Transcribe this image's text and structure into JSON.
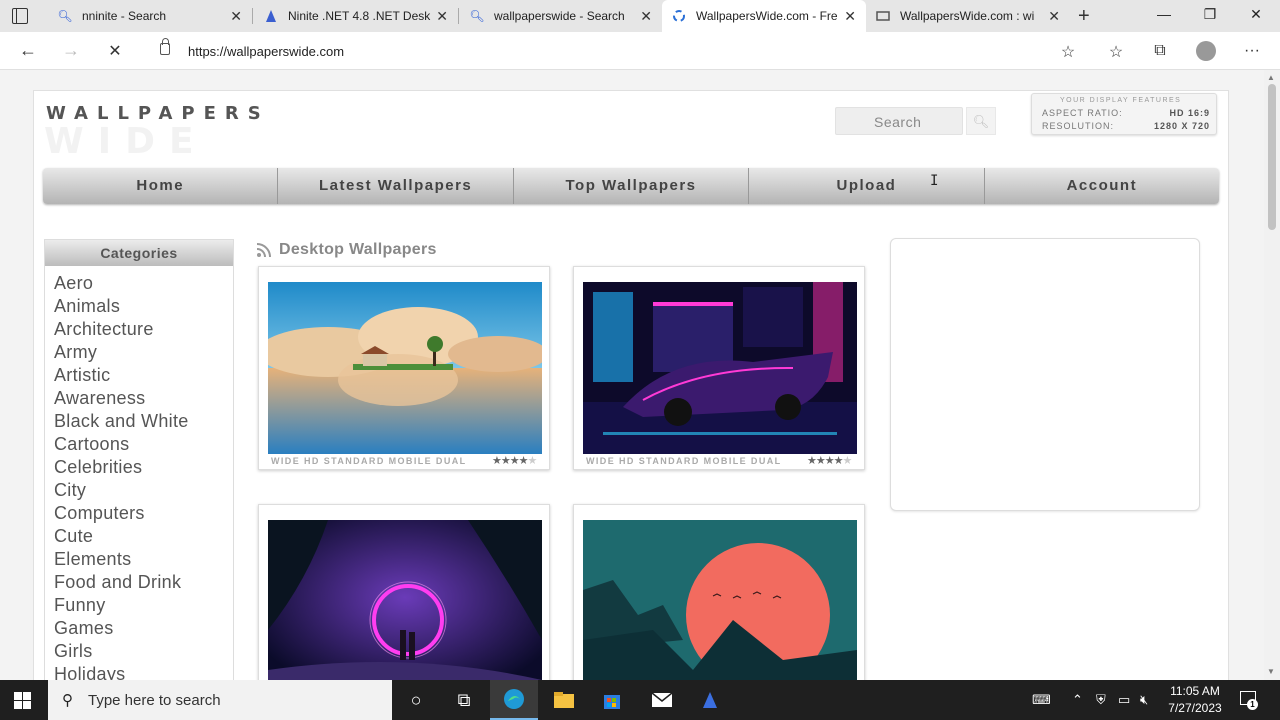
{
  "browser": {
    "tabs": [
      {
        "label": "nninite - Search",
        "icon": "search-icon",
        "active": false
      },
      {
        "label": "Ninite .NET 4.8 .NET Desk",
        "icon": "ninite-icon",
        "active": false
      },
      {
        "label": "wallpaperswide - Search",
        "icon": "search-icon",
        "active": false
      },
      {
        "label": "WallpapersWide.com - Fre",
        "icon": "loading-spinner-icon",
        "active": true
      },
      {
        "label": "WallpapersWide.com : wi",
        "icon": "site-favicon-icon",
        "active": false
      }
    ],
    "url": "https://wallpaperswide.com"
  },
  "site": {
    "logo_top": "WALLPAPERS",
    "logo_bottom": "WIDE",
    "search_placeholder": "Search",
    "display_features": {
      "title": "YOUR DISPLAY FEATURES",
      "aspect_label": "ASPECT RATIO:",
      "aspect_value": "HD 16:9",
      "resolution_label": "RESOLUTION:",
      "resolution_value": "1280 X 720"
    },
    "nav": [
      "Home",
      "Latest Wallpapers",
      "Top Wallpapers",
      "Upload",
      "Account"
    ],
    "categories_title": "Categories",
    "categories": [
      "Aero",
      "Animals",
      "Architecture",
      "Army",
      "Artistic",
      "Awareness",
      "Black and White",
      "Cartoons",
      "Celebrities",
      "City",
      "Computers",
      "Cute",
      "Elements",
      "Food and Drink",
      "Funny",
      "Games",
      "Girls",
      "Holidays"
    ],
    "section_title": "Desktop Wallpapers",
    "wallpapers": [
      {
        "meta": "WIDE  HD  STANDARD  MOBILE  DUAL",
        "rating": 4,
        "subject": "house on island reflection"
      },
      {
        "meta": "WIDE  HD  STANDARD  MOBILE  DUAL",
        "rating": 4,
        "subject": "neon sports car"
      },
      {
        "meta": "",
        "rating": 0,
        "subject": "couple under neon ring"
      },
      {
        "meta": "",
        "rating": 0,
        "subject": "red sun over mountains"
      }
    ]
  },
  "taskbar": {
    "search_placeholder": "Type here to search",
    "time": "11:05 AM",
    "date": "7/27/2023",
    "notification_count": "1"
  },
  "colors": {
    "accent": "#76b9ed",
    "nav_text": "#444444",
    "category_text": "#555555"
  }
}
